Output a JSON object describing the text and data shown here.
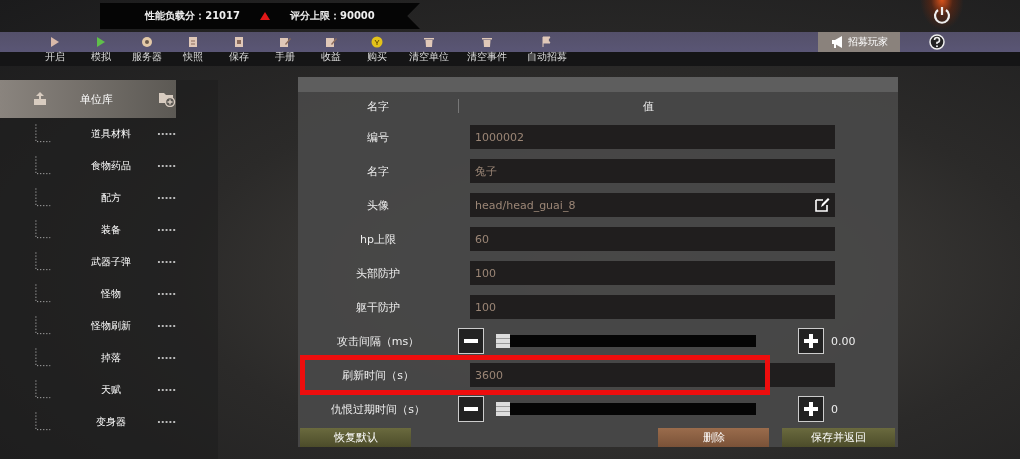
{
  "top_banner": {
    "load_score": "性能负载分：21017",
    "score_limit": "评分上限：90000"
  },
  "toolbar": {
    "items": [
      {
        "label": "开启"
      },
      {
        "label": "模拟"
      },
      {
        "label": "服务器"
      },
      {
        "label": "快照"
      },
      {
        "label": "保存"
      },
      {
        "label": "手册"
      },
      {
        "label": "收益"
      },
      {
        "label": "购买"
      },
      {
        "label": "清空单位"
      },
      {
        "label": "清空事件"
      },
      {
        "label": "自动招募"
      }
    ],
    "recruit_button": "招募玩家"
  },
  "sidebar": {
    "tree": [
      {
        "label": "单位库",
        "children": [
          {
            "label": "道具材料"
          },
          {
            "label": "食物药品"
          },
          {
            "label": "配方"
          },
          {
            "label": "装备"
          },
          {
            "label": "武器子弹"
          },
          {
            "label": "怪物"
          },
          {
            "label": "怪物刷新"
          },
          {
            "label": "掉落"
          },
          {
            "label": "天赋"
          },
          {
            "label": "变身器"
          }
        ]
      }
    ]
  },
  "editor": {
    "columns": [
      "名字",
      "值"
    ],
    "rows": [
      {
        "kind": "text",
        "label": "编号",
        "value": "1000002"
      },
      {
        "kind": "text",
        "label": "名字",
        "value": "兔子"
      },
      {
        "kind": "edit",
        "label": "头像",
        "value": "head/head_guai_8"
      },
      {
        "kind": "text",
        "label": "hp上限",
        "value": "60"
      },
      {
        "kind": "text",
        "label": "头部防护",
        "value": "100"
      },
      {
        "kind": "text",
        "label": "躯干防护",
        "value": "100"
      },
      {
        "kind": "slider",
        "label": "攻击间隔（ms）",
        "level": 0,
        "reading": "0.00"
      },
      {
        "kind": "text",
        "label": "刷新时间（s）",
        "value": "3600",
        "highlighted": true
      },
      {
        "kind": "slider",
        "label": "仇恨过期时间（s）",
        "level": 0,
        "reading": "0"
      }
    ],
    "buttons": [
      {
        "kind": "reset",
        "label": "恢复默认"
      },
      {
        "kind": "delete",
        "label": "删除"
      },
      {
        "kind": "save",
        "label": "保存并返回"
      }
    ]
  }
}
